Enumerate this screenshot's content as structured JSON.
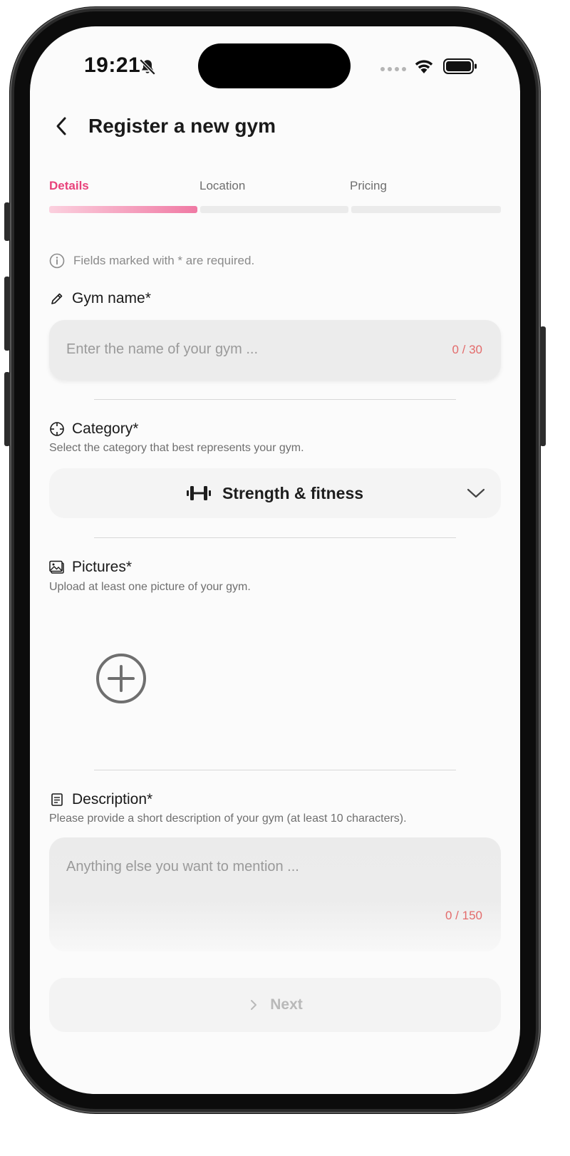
{
  "status_bar": {
    "time": "19:21"
  },
  "header": {
    "title": "Register a new gym"
  },
  "steps": [
    {
      "label": "Details",
      "active": true
    },
    {
      "label": "Location",
      "active": false
    },
    {
      "label": "Pricing",
      "active": false
    }
  ],
  "info": {
    "text": "Fields marked with * are required."
  },
  "gym_name": {
    "label": "Gym name*",
    "placeholder": "Enter the name of your gym ...",
    "counter": "0 / 30"
  },
  "category": {
    "label": "Category*",
    "subtitle": "Select the category that best represents your gym.",
    "selected": "Strength & fitness"
  },
  "pictures": {
    "label": "Pictures*",
    "subtitle": "Upload at least one picture of your gym."
  },
  "description": {
    "label": "Description*",
    "subtitle": "Please provide a short description of your gym (at least 10 characters).",
    "placeholder": "Anything else you want to mention ...",
    "counter": "0 / 150"
  },
  "footer": {
    "next_label": "Next"
  },
  "colors": {
    "accent": "#e8427b",
    "counter": "#e36b6b"
  },
  "icons": {
    "back": "chevron-left-icon",
    "info": "info-icon",
    "gym_name": "pencil-icon",
    "category": "crosshair-icon",
    "category_value": "dumbbell-icon",
    "pictures": "image-icon",
    "add_picture": "plus-circle-icon",
    "description": "document-icon",
    "next": "chevron-right-icon"
  }
}
